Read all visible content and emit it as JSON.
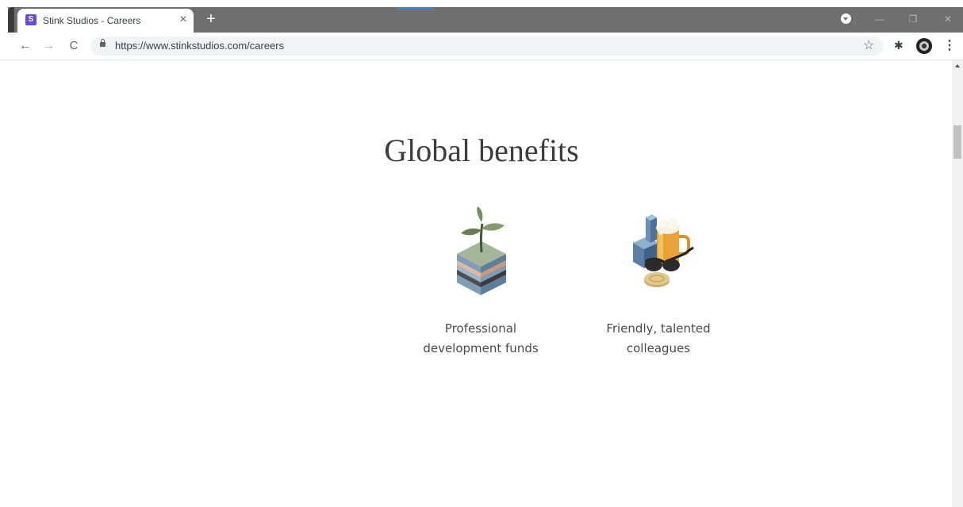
{
  "browser": {
    "tab": {
      "favicon_letter": "S",
      "title": "Stink Studios - Careers",
      "close": "×"
    },
    "new_tab": "+",
    "window_controls": {
      "minimize": "—",
      "maximize": "❐",
      "close": "✕"
    },
    "nav": {
      "back": "←",
      "forward": "→",
      "reload": "C"
    },
    "url": "https://www.stinkstudios.com/careers",
    "bookmark": "☆",
    "extensions": "✱",
    "menu": "⋮"
  },
  "page": {
    "heading": "Global benefits",
    "benefits": [
      {
        "line1": "Professional",
        "line2": "development funds",
        "icon": "plant-soil-layers-icon"
      },
      {
        "line1": "Friendly, talented",
        "line2": "colleagues",
        "icon": "beer-sunglasses-icon"
      }
    ]
  }
}
